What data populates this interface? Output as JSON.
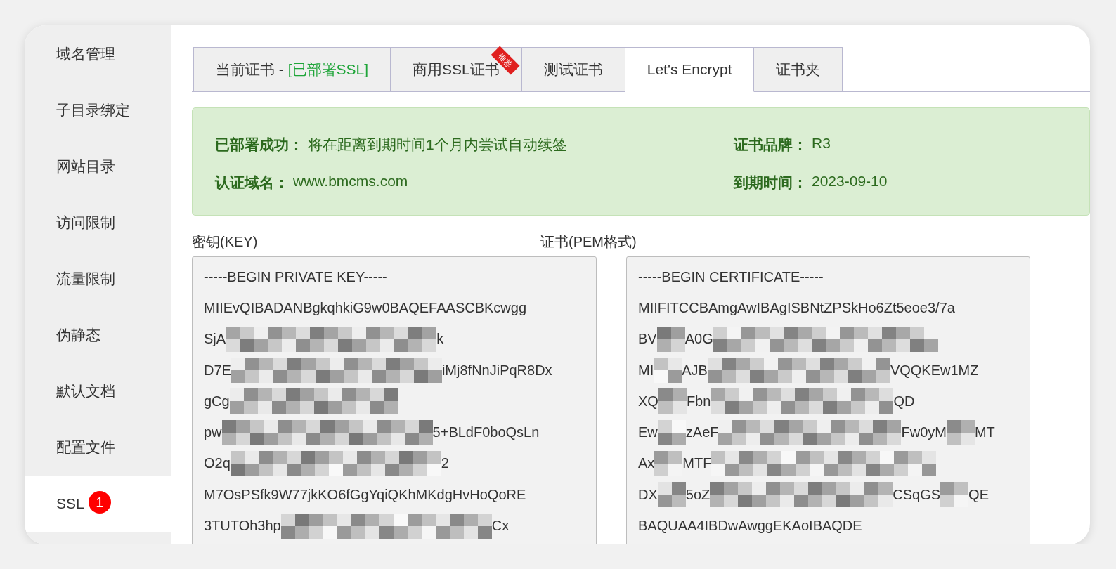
{
  "sidebar": {
    "items": [
      {
        "label": "域名管理",
        "selected": false
      },
      {
        "label": "子目录绑定",
        "selected": false
      },
      {
        "label": "网站目录",
        "selected": false
      },
      {
        "label": "访问限制",
        "selected": false
      },
      {
        "label": "流量限制",
        "selected": false
      },
      {
        "label": "伪静态",
        "selected": false
      },
      {
        "label": "默认文档",
        "selected": false
      },
      {
        "label": "配置文件",
        "selected": false
      },
      {
        "label": "SSL",
        "selected": true,
        "badge": "1"
      }
    ]
  },
  "tabs": [
    {
      "label": "当前证书 - ",
      "status": "[已部署SSL]",
      "selected": false
    },
    {
      "label": "商用SSL证书",
      "ribbon": "推荐",
      "selected": false
    },
    {
      "label": "测试证书",
      "selected": false
    },
    {
      "label": "Let's Encrypt",
      "selected": true
    },
    {
      "label": "证书夹",
      "selected": false
    }
  ],
  "status_panel": {
    "fields": [
      {
        "label": "已部署成功：",
        "value": "将在距离到期时间1个月内尝试自动续签"
      },
      {
        "label": "证书品牌：",
        "value": "R3"
      },
      {
        "label": "认证域名：",
        "value": "www.bmcms.com"
      },
      {
        "label": "到期时间：",
        "value": "2023-09-10"
      }
    ]
  },
  "fields": [
    {
      "label": "密钥(KEY)",
      "lines": [
        {
          "parts": [
            "-----BEGIN PRIVATE KEY-----"
          ]
        },
        {
          "parts": [
            "MIIEvQIBADANBgkqhkiG9w0BAQEFAASCBKcwgg"
          ]
        },
        {
          "parts": [
            "SjA",
            "k"
          ]
        },
        {
          "parts": [
            "D7E",
            "iMj8fNnJiPqR8Dx"
          ]
        },
        {
          "parts": [
            "gCg"
          ],
          "masked_end": true
        },
        {
          "parts": [
            "pw",
            "5+BLdF0boQsLn"
          ]
        },
        {
          "parts": [
            "O2q",
            "2"
          ]
        },
        {
          "parts": [
            "M7OsPSfk9W77jkKO6fGgYqiQKhMKdgHvHoQoRE"
          ]
        },
        {
          "parts": [
            "3TUTOh3hp",
            "Cx"
          ]
        }
      ]
    },
    {
      "label": "证书(PEM格式)",
      "lines": [
        {
          "parts": [
            "-----BEGIN CERTIFICATE-----"
          ]
        },
        {
          "parts": [
            "MIIFITCCBAmgAwIBAgISBNtZPSkHo6Zt5eoe3/7a"
          ]
        },
        {
          "parts": [
            "BV",
            "A0G"
          ],
          "masked_end": true
        },
        {
          "parts": [
            "MI",
            "AJB",
            "VQQKEw1MZ"
          ]
        },
        {
          "parts": [
            "XQ",
            "Fbn",
            "QD"
          ]
        },
        {
          "parts": [
            "Ew",
            "zAeF",
            "Fw0yM",
            "MT"
          ]
        },
        {
          "parts": [
            "Ax",
            "MTF"
          ],
          "masked_end": true
        },
        {
          "parts": [
            "DX",
            "5oZ",
            "CSqGS",
            "QE"
          ]
        },
        {
          "parts": [
            "BAQUAA4IBDwAwggEKAoIBAQDE"
          ]
        }
      ]
    }
  ]
}
